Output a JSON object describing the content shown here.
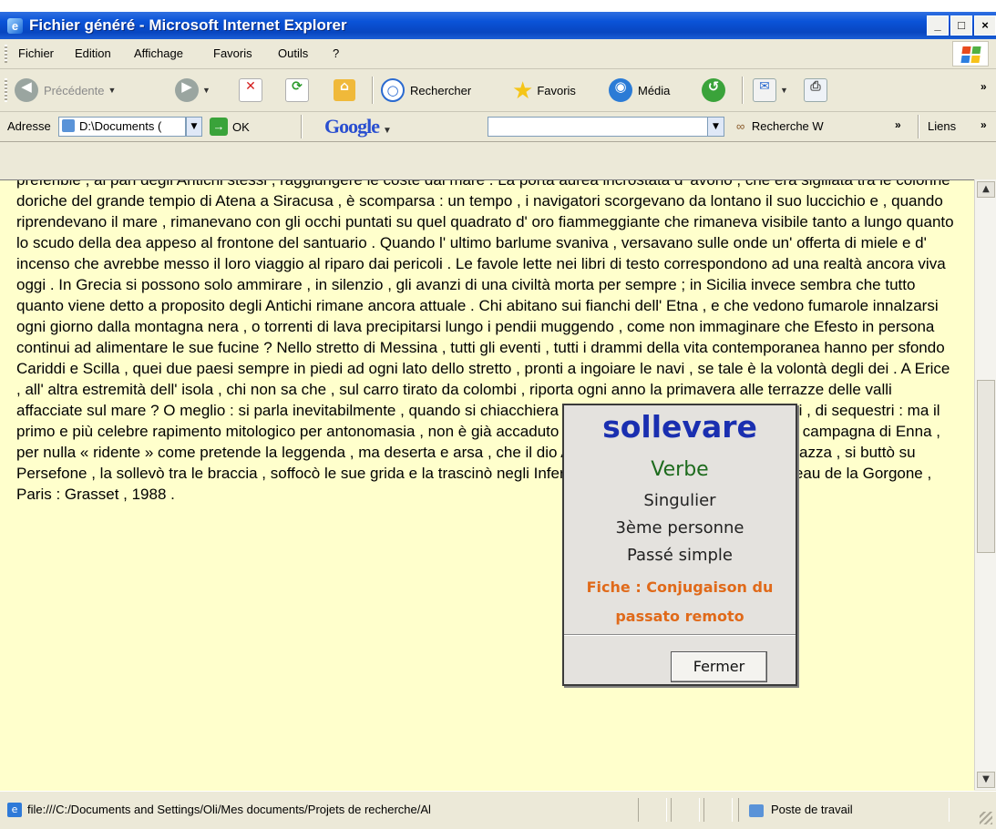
{
  "window": {
    "title": "Fichier généré - Microsoft Internet Explorer",
    "controls": [
      "_",
      "□",
      "×"
    ]
  },
  "menu": {
    "items": [
      "Fichier",
      "Edition",
      "Affichage",
      "Favoris",
      "Outils",
      "?"
    ]
  },
  "toolbar": {
    "back_label": "Précédente",
    "search_label": "Rechercher",
    "favorites_label": "Favoris",
    "media_label": "Média",
    "overflow": "»"
  },
  "address": {
    "label": "Adresse",
    "value": "D:\\Documents (",
    "go_label": "OK",
    "google_logo": "Google",
    "google_value": "",
    "google_search_label": "Recherche W",
    "links_label": "Liens",
    "overflow": "»"
  },
  "content": {
    "text": "préférible , al pari degli Antichi stessi , raggiungere le coste dal mare . La porta aurea incrostata d' avorio , che era sigillata tra le colonne doriche del grande tempio di Atena a Siracusa , è scomparsa : un tempo , i navigatori scorgevano da lontano il suo luccichio e , quando riprendevano il mare , rimanevano con gli occhi puntati su quel quadrato d' oro fiammeggiante che rimaneva visibile tanto a lungo quanto lo scudo della dea appeso al frontone del santuario . Quando l' ultimo barlume svaniva , versavano sulle onde un' offerta di miele e d' incenso che avrebbe messo il loro viaggio al riparo dai pericoli . Le favole lette nei libri di testo correspondono ad una realtà ancora viva oggi . In Grecia si possono solo ammirare , in silenzio , gli avanzi di una civiltà morta per sempre ; in Sicilia invece sembra che tutto quanto viene detto a proposito degli Antichi rimane ancora attuale . Chi abitano sui fianchi dell' Etna , e che vedono fumarole innalzarsi ogni giorno dalla montagna nera , o torrenti di lava precipitarsi lungo i pendii muggendo , come non immaginare che Efesto in persona continui ad alimentare le sue fucine ? Nello stretto di Messina , tutti gli eventi , tutti i drammi della vita contemporanea hanno per sfondo Cariddi e Scilla , quei due paesi sempre in piedi ad ogni lato dello stretto , pronti a ingoiare le navi , se tale è la volontà degli dei . A Erice , all' altra estremità dell' isola , chi non sa che , sul carro tirato da colombi , riporta ogni anno la primavera alle terrazze delle valli affacciate sul mare ? O meglio : si parla inevitabilmente , quando si chiacchiera de sulla Sicilia , di violenze , di ratti , di sequestri : ma il primo e più celebre rapimento mitologico per antonomasia , non è già accaduto in Sicilia , sulle rive del lago , nella campagna di Enna , per nulla « ridente » come pretende la leggenda , ma deserta e arsa , che il dio Ade , sedotto dalle grazie della ragazza , si buttò su Persefone , la sollevò tra le braccia , soffocò le sue grida e la trascinò negli Inferi ? Dominique Fernandez , Le radeau de la Gorgone , Paris : Grasset , 1988 ."
  },
  "popup": {
    "word": "sollevare",
    "pos": "Verbe",
    "number": "Singulier",
    "person": "3ème personne",
    "tense": "Passé simple",
    "link_line1": "Fiche : Conjugaison du",
    "link_line2": "passato remoto",
    "close_label": "Fermer"
  },
  "status": {
    "url": "file:///C:/Documents and Settings/Oli/Mes documents/Projets de recherche/Al",
    "zone": "Poste de travail"
  },
  "colors": {
    "titlebar": "#0a53d8",
    "page_background": "#ffffcc",
    "popup_word": "#1a2fb0",
    "popup_pos": "#1d6b1d",
    "popup_link": "#e06a1a"
  }
}
